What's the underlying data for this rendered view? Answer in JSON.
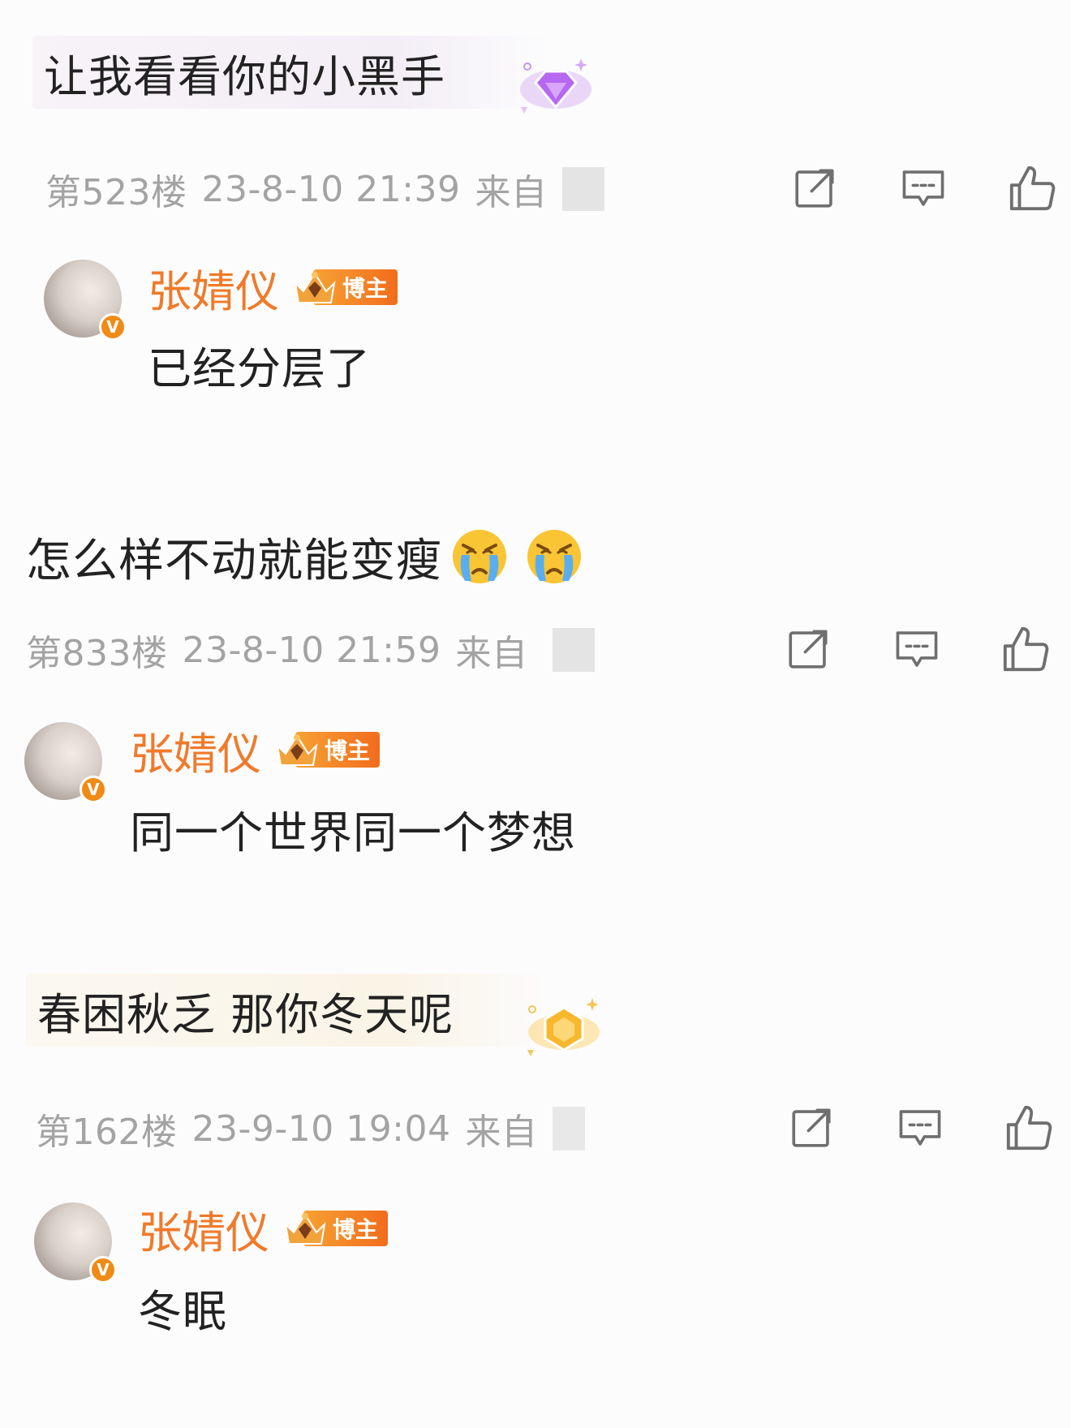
{
  "comments": [
    {
      "text": "让我看看你的小黑手",
      "meta": {
        "floor": "第523楼",
        "datetime": "23-8-10 21:39",
        "source": "来自"
      },
      "reply": {
        "name": "张婧仪",
        "tag": "博主",
        "verified": "V",
        "text": "已经分层了"
      }
    },
    {
      "text": "怎么样不动就能变瘦",
      "meta": {
        "floor": "第833楼",
        "datetime": "23-8-10 21:59",
        "source": "来自"
      },
      "reply": {
        "name": "张婧仪",
        "tag": "博主",
        "verified": "V",
        "text": "同一个世界同一个梦想"
      }
    },
    {
      "text": "春困秋乏 那你冬天呢",
      "meta": {
        "floor": "第162楼",
        "datetime": "23-9-10 19:04",
        "source": "来自"
      },
      "reply": {
        "name": "张婧仪",
        "tag": "博主",
        "verified": "V",
        "text": "冬眠"
      }
    }
  ],
  "icons": {
    "share": "share-icon",
    "comment": "comment-icon",
    "like": "thumbs-up-icon",
    "fan_badge_purple": "purple-diamond-fan-badge-icon",
    "fan_badge_gold": "gold-fan-badge-icon",
    "crying_emoji": "crying-face-emoji-icon",
    "crown_badge": "crown-badge-icon"
  },
  "colors": {
    "name": "#f07a2a",
    "meta": "#a3a3a3",
    "tag_start": "#f7a233",
    "tag_end": "#f26c1d",
    "purple_bubble": "#f3eef6",
    "gold_bubble": "#faf4e6"
  }
}
